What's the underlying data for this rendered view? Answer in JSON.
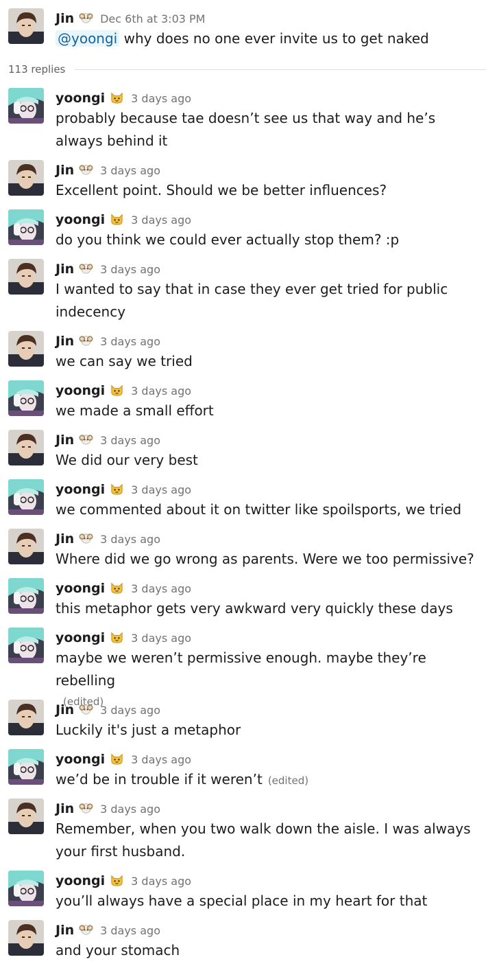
{
  "parent": {
    "author": "Jin",
    "emoji": "ram-emoji",
    "timestamp": "Dec 6th at 3:03 PM",
    "mention": "@yoongi",
    "text": "why does no one ever invite us to get naked"
  },
  "thread": {
    "replies_label": "113 replies"
  },
  "messages": [
    {
      "author": "yoongi",
      "emoji": "cat-emoji",
      "time": "3 days ago",
      "text": "probably because tae doesn’t see us that way and he’s always behind it",
      "edited": ""
    },
    {
      "author": "Jin",
      "emoji": "ram-emoji",
      "time": "3 days ago",
      "text": "Excellent point. Should we be better influences?",
      "edited": ""
    },
    {
      "author": "yoongi",
      "emoji": "cat-emoji",
      "time": "3 days ago",
      "text": "do you think we could ever actually stop them? :p",
      "edited": ""
    },
    {
      "author": "Jin",
      "emoji": "ram-emoji",
      "time": "3 days ago",
      "text": "I wanted to say that in case they ever get tried for public indecency",
      "edited": ""
    },
    {
      "author": "Jin",
      "emoji": "ram-emoji",
      "time": "3 days ago",
      "text": "we can say we tried",
      "edited": ""
    },
    {
      "author": "yoongi",
      "emoji": "cat-emoji",
      "time": "3 days ago",
      "text": "we made a small effort",
      "edited": ""
    },
    {
      "author": "Jin",
      "emoji": "ram-emoji",
      "time": "3 days ago",
      "text": "We did our very best",
      "edited": ""
    },
    {
      "author": "yoongi",
      "emoji": "cat-emoji",
      "time": "3 days ago",
      "text": "we commented about it on twitter like spoilsports, we tried",
      "edited": ""
    },
    {
      "author": "Jin",
      "emoji": "ram-emoji",
      "time": "3 days ago",
      "text": "Where did we go wrong as parents. Were we too permissive?",
      "edited": ""
    },
    {
      "author": "yoongi",
      "emoji": "cat-emoji",
      "time": "3 days ago",
      "text": "this metaphor gets very awkward very quickly these days",
      "edited": ""
    },
    {
      "author": "yoongi",
      "emoji": "cat-emoji",
      "time": "3 days ago",
      "text": "maybe we weren’t permissive enough. maybe they’re rebelling",
      "edited": "(edited)"
    },
    {
      "author": "Jin",
      "emoji": "ram-emoji",
      "time": "3 days ago",
      "text": "Luckily it's just a metaphor",
      "edited": ""
    },
    {
      "author": "yoongi",
      "emoji": "cat-emoji",
      "time": "3 days ago",
      "text": "we’d be in trouble if it weren’t",
      "edited": "(edited)"
    },
    {
      "author": "Jin",
      "emoji": "ram-emoji",
      "time": "3 days ago",
      "text": "Remember, when you two walk down the aisle. I was always your first husband.",
      "edited": ""
    },
    {
      "author": "yoongi",
      "emoji": "cat-emoji",
      "time": "3 days ago",
      "text": "you’ll always have a special place in my heart for that",
      "edited": ""
    },
    {
      "author": "Jin",
      "emoji": "ram-emoji",
      "time": "3 days ago",
      "text": "and your stomach",
      "edited": ""
    }
  ]
}
